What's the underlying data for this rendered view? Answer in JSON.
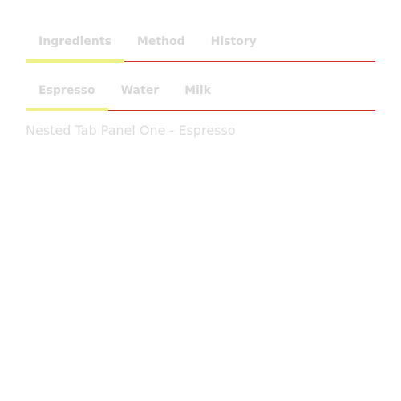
{
  "outer_tabs": {
    "items": [
      {
        "label": "Ingredients"
      },
      {
        "label": "Method"
      },
      {
        "label": "History"
      }
    ],
    "active_index": 0
  },
  "inner_tabs": {
    "items": [
      {
        "label": "Espresso"
      },
      {
        "label": "Water"
      },
      {
        "label": "Milk"
      }
    ],
    "active_index": 0
  },
  "panel": {
    "text": "Nested Tab Panel One - Espresso"
  },
  "colors": {
    "tab_text": "#d8d8d8",
    "divider": "#c9302c",
    "active_indicator": "#f0f08a",
    "panel_text": "#dddddd"
  }
}
